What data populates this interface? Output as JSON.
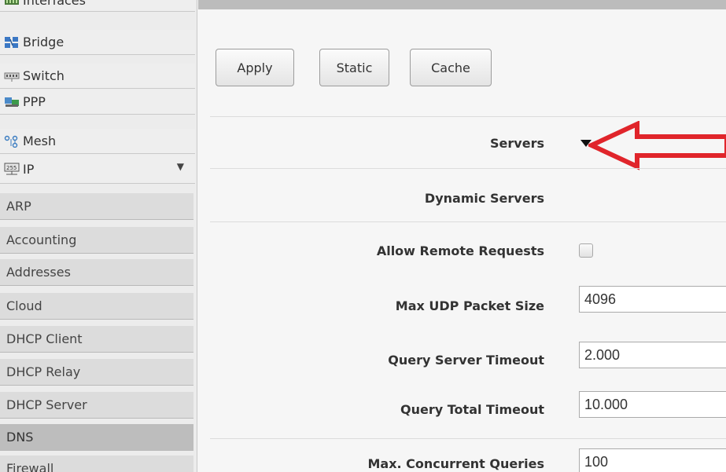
{
  "sidebar": {
    "items": [
      {
        "label": "Interfaces",
        "icon": "interfaces-icon"
      },
      {
        "label": "Bridge",
        "icon": "bridge-icon"
      },
      {
        "label": "Switch",
        "icon": "switch-icon"
      },
      {
        "label": "PPP",
        "icon": "ppp-icon"
      },
      {
        "label": "Mesh",
        "icon": "mesh-icon"
      },
      {
        "label": "IP",
        "icon": "ip-icon",
        "expanded_marker": "▼"
      }
    ],
    "ip_subitems": [
      {
        "label": "ARP"
      },
      {
        "label": "Accounting"
      },
      {
        "label": "Addresses"
      },
      {
        "label": "Cloud"
      },
      {
        "label": "DHCP Client"
      },
      {
        "label": "DHCP Relay"
      },
      {
        "label": "DHCP Server"
      },
      {
        "label": "DNS",
        "active": true
      },
      {
        "label": "Firewall"
      }
    ]
  },
  "toolbar": {
    "apply_label": "Apply",
    "static_label": "Static",
    "cache_label": "Cache"
  },
  "form": {
    "servers_label": "Servers",
    "dynamic_servers_label": "Dynamic Servers",
    "allow_remote_label": "Allow Remote Requests",
    "allow_remote_checked": false,
    "max_udp_label": "Max UDP Packet Size",
    "max_udp_value": "4096",
    "query_server_timeout_label": "Query Server Timeout",
    "query_server_timeout_value": "2.000",
    "query_total_timeout_label": "Query Total Timeout",
    "query_total_timeout_value": "10.000",
    "max_concurrent_label": "Max. Concurrent Queries",
    "max_concurrent_value": "100"
  },
  "colors": {
    "annotation_arrow": "#e0252b",
    "active_nav": "#bdbdbd"
  }
}
